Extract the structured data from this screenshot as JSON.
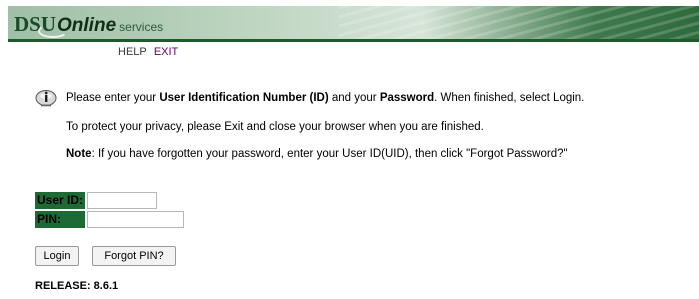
{
  "header": {
    "logo_dsu": "DSU",
    "logo_online": "Online",
    "logo_services": "services"
  },
  "nav": {
    "help": "HELP",
    "exit": "EXIT"
  },
  "messages": {
    "line1_prefix": "Please enter your ",
    "line1_b1": "User Identification Number (ID)",
    "line1_mid": " and your ",
    "line1_b2": "Password",
    "line1_suffix": ". When finished, select Login.",
    "line2": "To protect your privacy, please Exit and close your browser when you are finished.",
    "line3_label": "Note",
    "line3_text": ": If you have forgotten your password, enter your User ID(UID), then click \"Forgot Password?\""
  },
  "form": {
    "user_id_label": "User ID:",
    "user_id_value": "",
    "pin_label": "PIN:",
    "pin_value": ""
  },
  "buttons": {
    "login": "Login",
    "forgot": "Forgot PIN?"
  },
  "footer": {
    "release": "RELEASE: 8.6.1"
  },
  "colors": {
    "banner_dark": "#1f5a2c",
    "label_bg": "#1d6a35",
    "exit_link": "#660066"
  },
  "icons": {
    "info": "info-icon"
  }
}
